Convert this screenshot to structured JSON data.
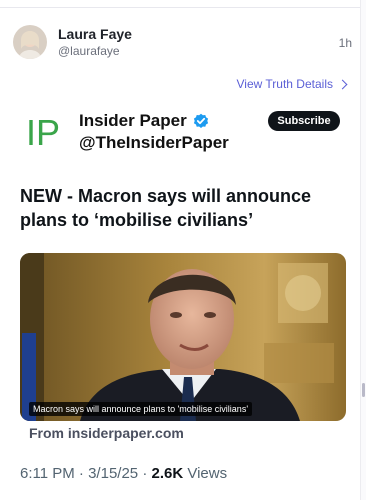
{
  "post": {
    "author_name": "Laura Faye",
    "author_handle": "@laurafaye",
    "age": "1h",
    "view_details_label": "View Truth Details"
  },
  "embed": {
    "logo_text": "IP",
    "source_name": "Insider Paper",
    "source_handle": "@TheInsiderPaper",
    "subscribe_label": "Subscribe",
    "headline": "NEW - Macron says will announce plans to ‘mobilise civilians’",
    "image_caption": "Macron says will announce plans to 'mobilise civilians'",
    "link_source": "From insiderpaper.com",
    "time": "6:11 PM",
    "date": "3/15/25",
    "views_count": "2.6K",
    "views_label": "Views",
    "separator": "·"
  },
  "icons": {
    "verified": "verified-badge-icon",
    "chevron": "chevron-right-icon"
  },
  "colors": {
    "accent": "#5b5fd6",
    "logo_green": "#3aa54a",
    "verified_blue": "#1d9bf0"
  }
}
